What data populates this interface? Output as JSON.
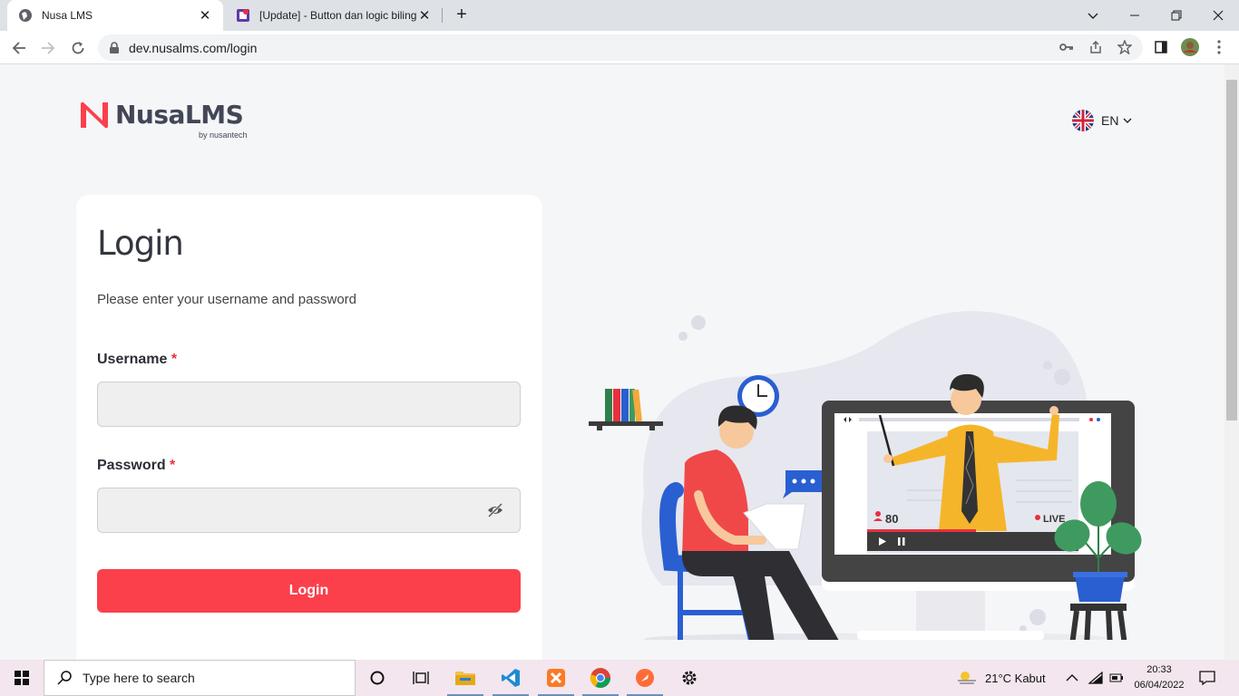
{
  "browser": {
    "tabs": [
      {
        "title": "Nusa LMS",
        "active": true
      },
      {
        "title": "[Update] - Button dan logic biling",
        "active": false
      }
    ],
    "url": "dev.nusalms.com/login"
  },
  "header": {
    "brand": "NusaLMS",
    "brand_sub": "by nusantech",
    "language": "EN"
  },
  "login": {
    "title": "Login",
    "subtitle": "Please enter your username and password",
    "username_label": "Username",
    "password_label": "Password",
    "required_mark": "*",
    "username_value": "",
    "password_value": "",
    "submit_label": "Login"
  },
  "illustration": {
    "viewers": "80",
    "live_label": "LIVE"
  },
  "taskbar": {
    "search_placeholder": "Type here to search",
    "weather": "21°C  Kabut",
    "time": "20:33",
    "date": "06/04/2022"
  },
  "colors": {
    "brand_red": "#fb404b",
    "brand_dark": "#424656"
  }
}
